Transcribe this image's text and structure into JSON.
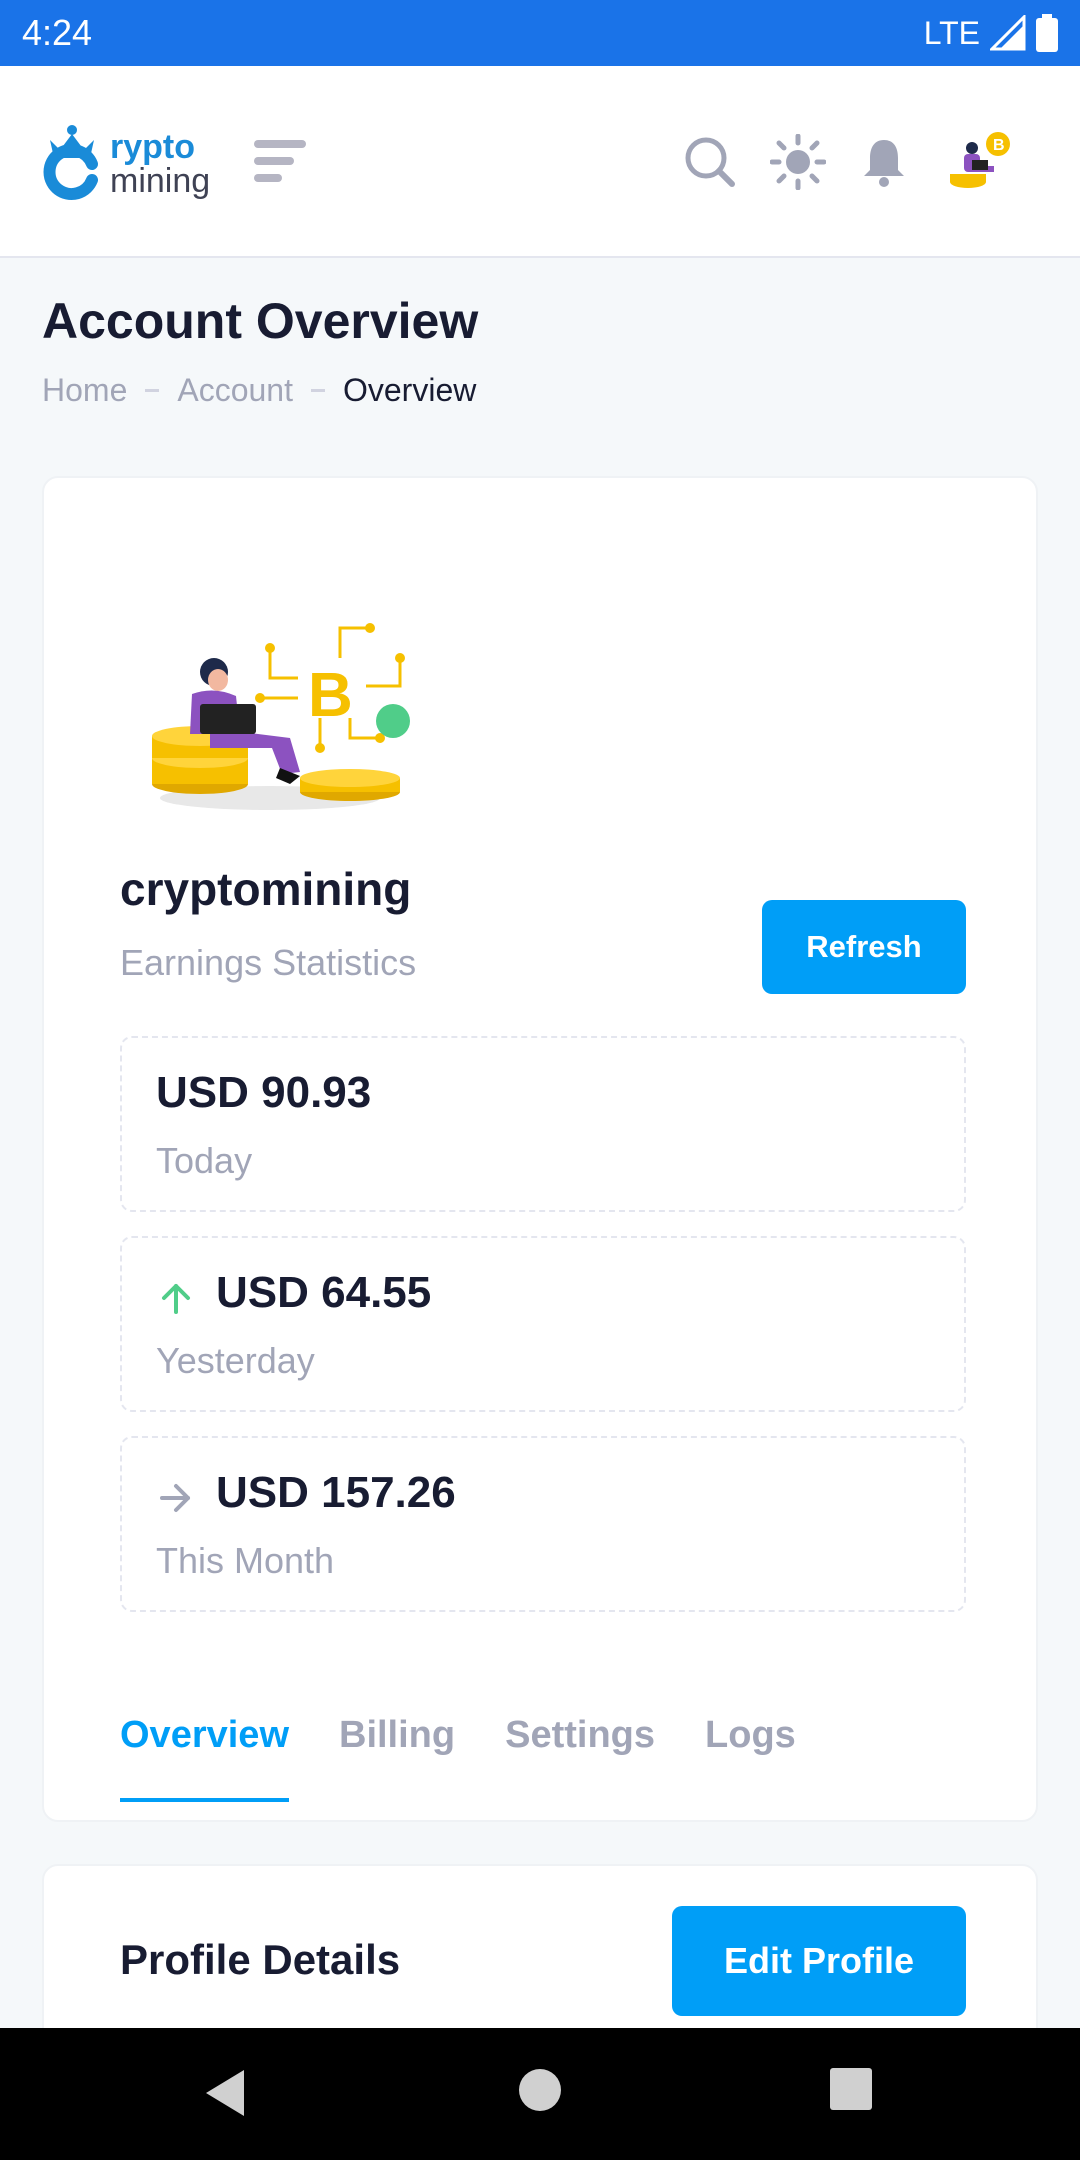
{
  "status_bar": {
    "time": "4:24",
    "network": "LTE"
  },
  "header": {
    "logo_top": "rypto",
    "logo_bottom": "mining",
    "icons": [
      "menu-icon",
      "search-icon",
      "theme-sun-icon",
      "bell-icon",
      "avatar"
    ]
  },
  "page": {
    "title": "Account Overview",
    "breadcrumb": [
      "Home",
      "Account",
      "Overview"
    ]
  },
  "account": {
    "name": "cryptomining",
    "subtitle": "Earnings Statistics",
    "refresh_label": "Refresh",
    "stats": [
      {
        "value": "USD 90.93",
        "label": "Today",
        "trend": "none"
      },
      {
        "value": "USD 64.55",
        "label": "Yesterday",
        "trend": "up"
      },
      {
        "value": "USD 157.26",
        "label": "This Month",
        "trend": "right"
      }
    ],
    "tabs": [
      {
        "label": "Overview",
        "active": true
      },
      {
        "label": "Billing",
        "active": false
      },
      {
        "label": "Settings",
        "active": false
      },
      {
        "label": "Logs",
        "active": false
      }
    ]
  },
  "profile": {
    "title": "Profile Details",
    "edit_label": "Edit Profile"
  },
  "colors": {
    "status_bar": "#1a73e8",
    "primary": "#009ef7",
    "success": "#50cd89",
    "muted": "#a1a5b7",
    "dark": "#181c32"
  }
}
